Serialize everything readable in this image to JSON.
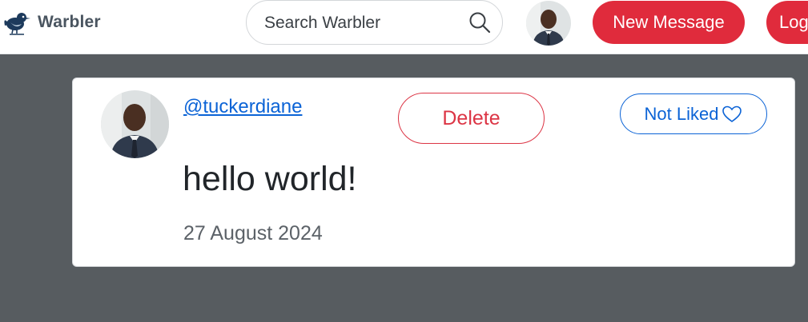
{
  "navbar": {
    "brand": {
      "name": "Warbler",
      "logo_icon": "warbler-bird-icon"
    },
    "search": {
      "placeholder": "Search Warbler",
      "value": "",
      "icon": "magnifier-icon"
    },
    "user_avatar": "user-avatar",
    "new_message_label": "New Message",
    "logout_label": "Log"
  },
  "message": {
    "username": "@tuckerdiane",
    "delete_label": "Delete",
    "like_label": "Not Liked",
    "like_icon": "heart-outline-icon",
    "text": "hello world!",
    "date": "27 August 2024"
  },
  "colors": {
    "page_background": "#575c60",
    "danger": "#e02b3c",
    "link": "#0b63d6",
    "card": "#ffffff"
  }
}
